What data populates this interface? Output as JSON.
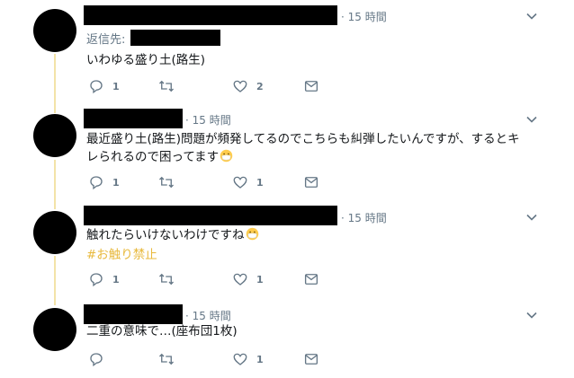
{
  "tweets": [
    {
      "time": "· 15 時間",
      "reply_label": "返信先:",
      "text": "いわゆる盛り土(路生)",
      "replies": "1",
      "retweets": "",
      "likes": "2"
    },
    {
      "time": "· 15 時間",
      "text_line1": "最近盛り土(路生)問題が頻発してるのでこちらも糾弾したいんですが、するとキ",
      "text_line2": "レられるので困ってます",
      "replies": "1",
      "retweets": "",
      "likes": "1"
    },
    {
      "time": "· 15 時間",
      "text": "触れたらいけないわけですね",
      "hashtag": "#お触り禁止",
      "replies": "1",
      "retweets": "",
      "likes": "1"
    },
    {
      "time": "· 15 時間",
      "text": "二重の意味で…(座布団1枚)",
      "replies": "",
      "retweets": "",
      "likes": "1"
    }
  ],
  "colors": {
    "thread_line": "#f3e3a8",
    "hashtag": "#e8b93c",
    "secondary_text": "#657786"
  },
  "icons": [
    "reply-icon",
    "retweet-icon",
    "like-icon",
    "message-icon",
    "chevron-down-icon",
    "mask-face-emoji-icon"
  ]
}
